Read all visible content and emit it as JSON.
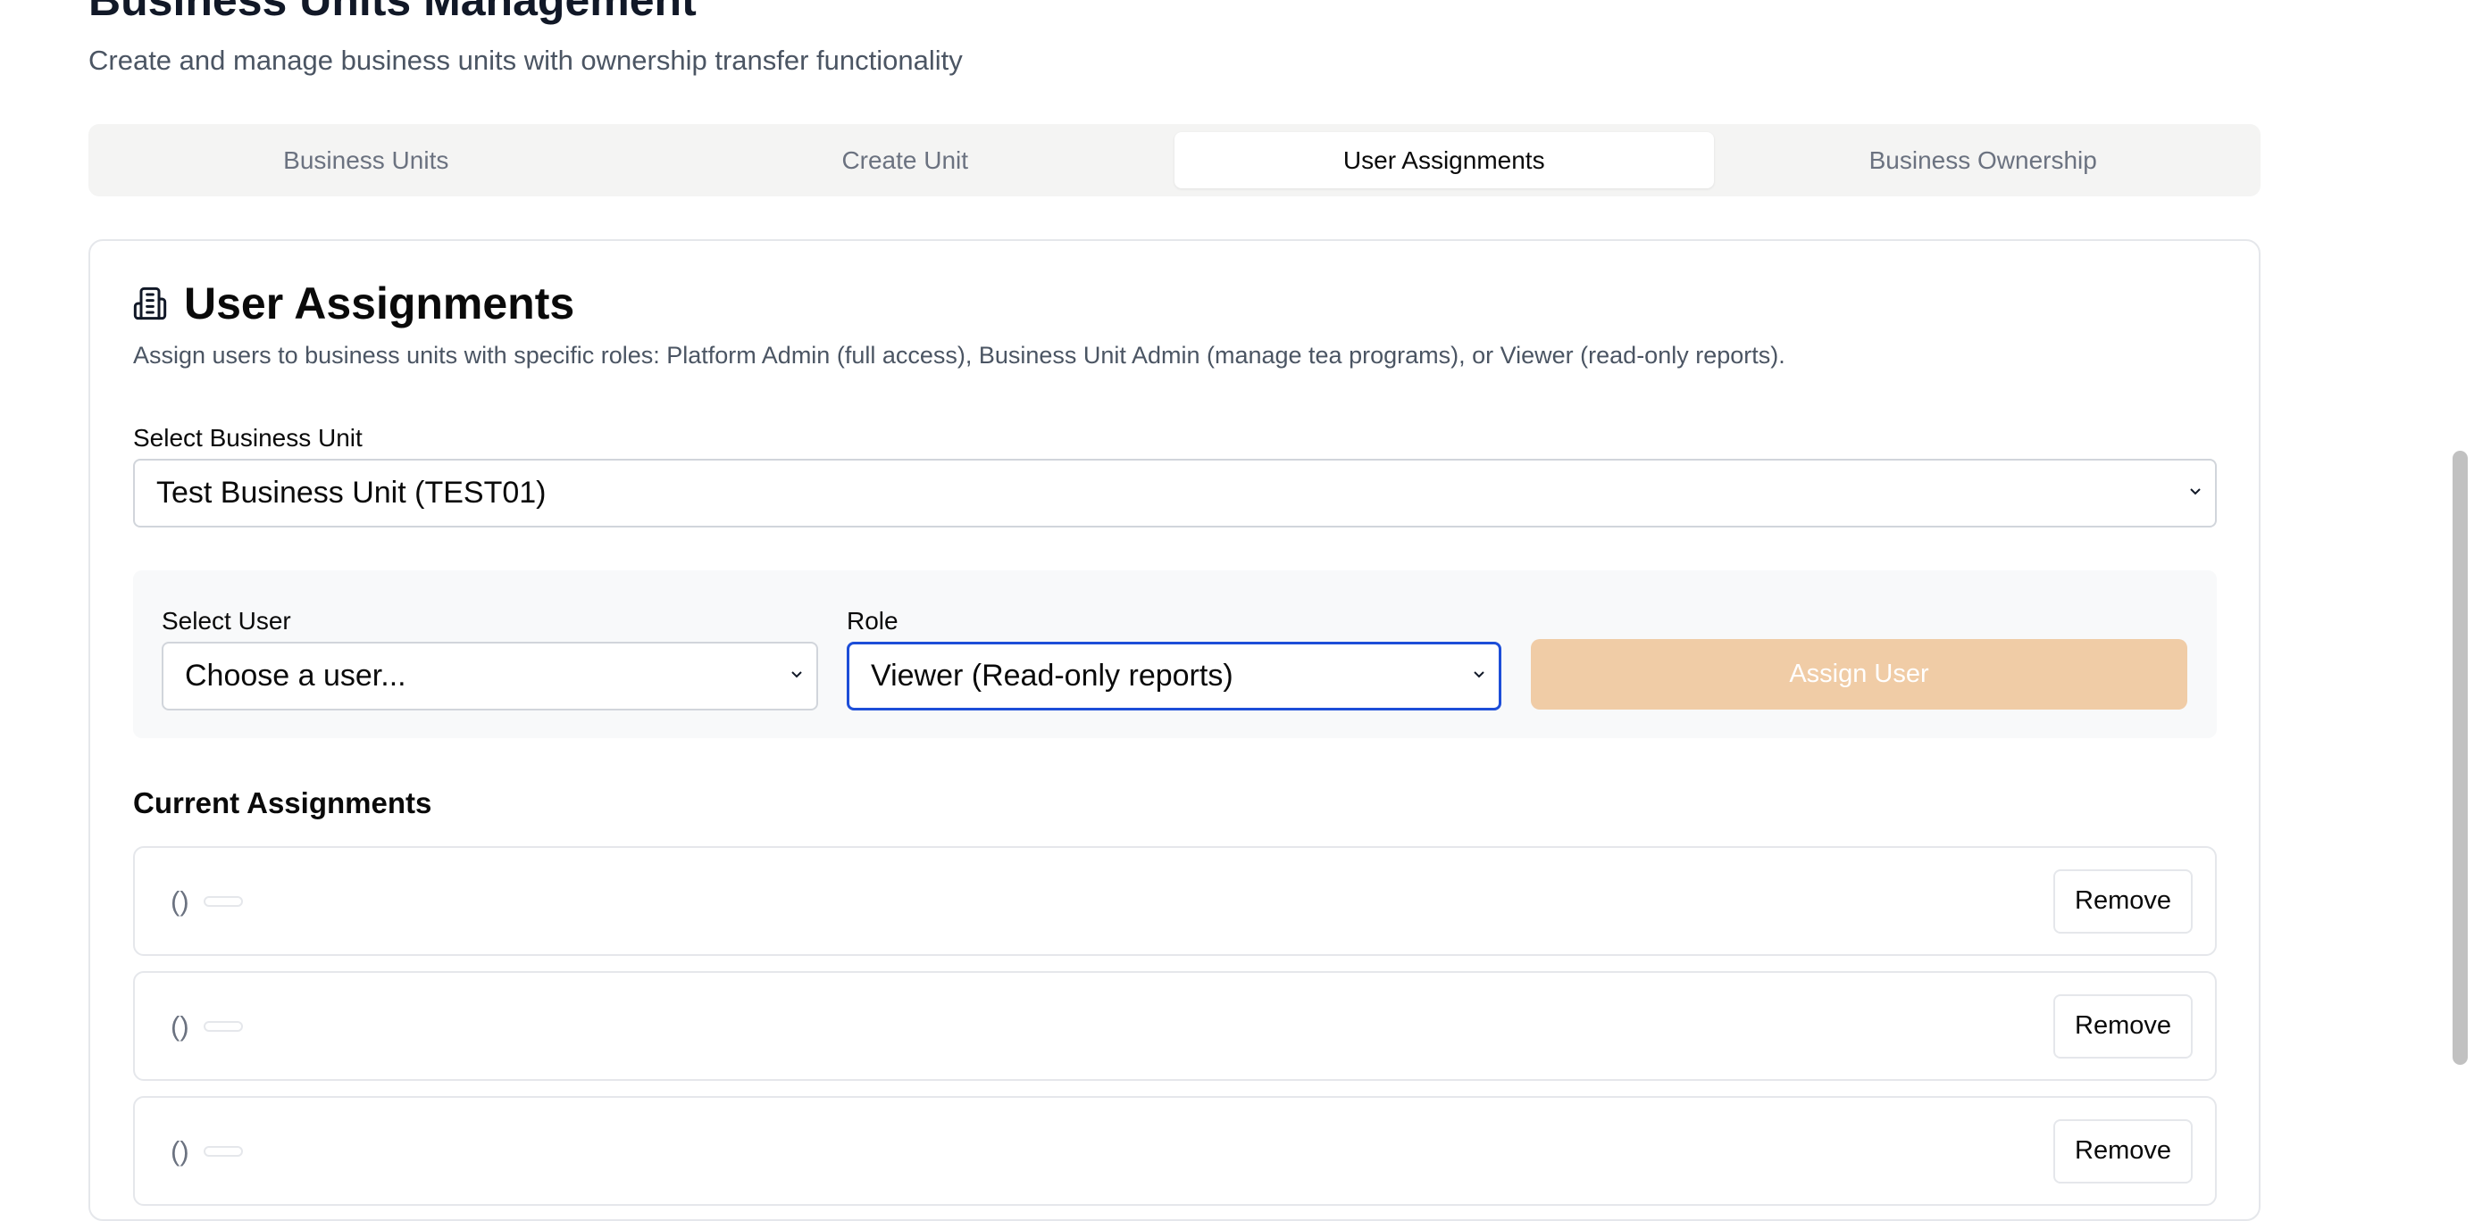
{
  "page": {
    "title": "Business Units Management",
    "subtitle": "Create and manage business units with ownership transfer functionality"
  },
  "tabs": [
    {
      "label": "Business Units",
      "active": false
    },
    {
      "label": "Create Unit",
      "active": false
    },
    {
      "label": "User Assignments",
      "active": true
    },
    {
      "label": "Business Ownership",
      "active": false
    }
  ],
  "card": {
    "icon": "building-icon",
    "title": "User Assignments",
    "description": "Assign users to business units with specific roles: Platform Admin (full access), Business Unit Admin (manage tea programs), or Viewer (read-only reports)."
  },
  "business_unit_select": {
    "label": "Select Business Unit",
    "value": "Test Business Unit (TEST01)"
  },
  "user_select": {
    "label": "Select User",
    "value": "Choose a user..."
  },
  "role_select": {
    "label": "Role",
    "value": "Viewer (Read-only reports)"
  },
  "assign_button": {
    "label": "Assign User",
    "color": "#f0cca6"
  },
  "current_assignments": {
    "title": "Current Assignments",
    "rows": [
      {
        "text": "()",
        "role": "",
        "action": "Remove"
      },
      {
        "text": "()",
        "role": "",
        "action": "Remove"
      },
      {
        "text": "()",
        "role": "",
        "action": "Remove"
      }
    ]
  },
  "colors": {
    "focus_ring": "#1d4ed8",
    "panel_background": "#f8f9fa",
    "tabs_background": "#f4f4f3"
  }
}
